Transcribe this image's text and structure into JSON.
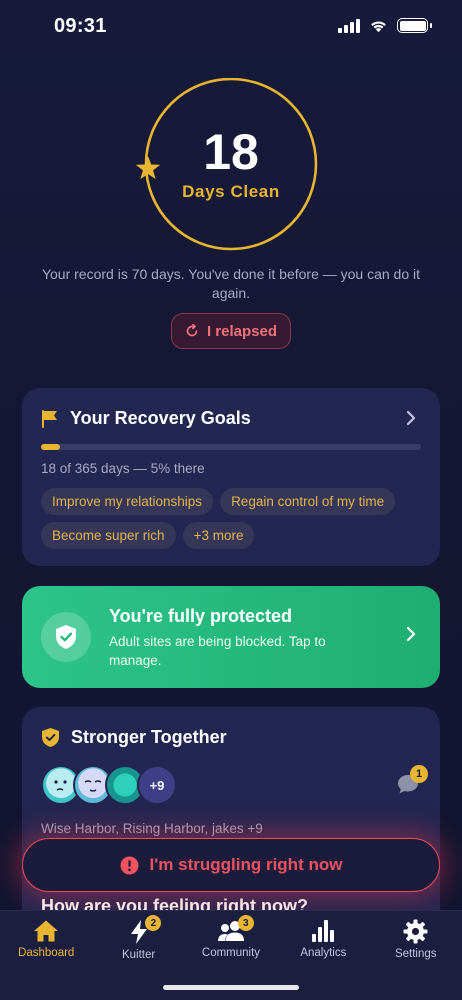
{
  "status_bar": {
    "time": "09:31"
  },
  "streak": {
    "days": "18",
    "label": "Days Clean"
  },
  "record_message": "Your record is 70 days. You've done it before — you can do it again.",
  "relapse_button": {
    "label": "I relapsed"
  },
  "goals": {
    "title": "Your Recovery Goals",
    "progress_fraction": 0.05,
    "progress_text": "18 of 365 days — 5% there",
    "chips": [
      "Improve my relationships",
      "Regain control of my time",
      "Become super rich",
      "+3 more"
    ]
  },
  "protection": {
    "title": "You're fully protected",
    "description": "Adult sites are being blocked. Tap to manage."
  },
  "together": {
    "title": "Stronger Together",
    "extra_count": "+9",
    "message_badge": "1",
    "names": "Wise Harbor, Rising Harbor, jakes +9"
  },
  "feeling": {
    "title": "How are you feeling right now?"
  },
  "struggle_button": {
    "label": "I'm struggling right now"
  },
  "tabs": [
    {
      "label": "Dashboard",
      "icon": "home-icon",
      "active": true
    },
    {
      "label": "Kuitter",
      "icon": "lightning-icon",
      "badge": "2"
    },
    {
      "label": "Community",
      "icon": "people-icon",
      "badge": "3"
    },
    {
      "label": "Analytics",
      "icon": "bar-chart-icon"
    },
    {
      "label": "Settings",
      "icon": "gear-icon"
    }
  ],
  "colors": {
    "accent": "#e7b530",
    "danger": "#f0535f",
    "success": "#2cc48a",
    "card": "#232650",
    "background": "#171a3a"
  }
}
